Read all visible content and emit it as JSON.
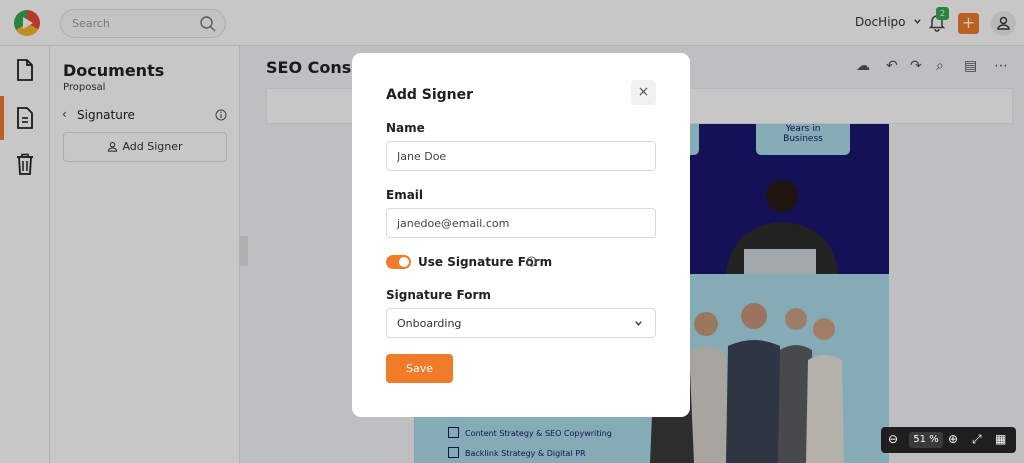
{
  "app": {
    "search": {
      "placeholder": "Search"
    },
    "brand_selector": "DocHipo",
    "notification_count": "2",
    "plus_label": "+"
  },
  "panel": {
    "title": "Documents",
    "subtitle": "Proposal",
    "section": "Signature",
    "add_signer_label": "Add Signer"
  },
  "document": {
    "title": "SEO Consu",
    "card_text": "Years in\nBusiness",
    "checklist": [
      "Content Strategy & SEO Copywriting",
      "Backlink Strategy & Digital PR"
    ]
  },
  "zoom": {
    "value": "51",
    "unit": "%"
  },
  "modal": {
    "title": "Add Signer",
    "close_label": "×",
    "name_label": "Name",
    "name_value": "Jane Doe",
    "email_label": "Email",
    "email_value": "janedoe@email.com",
    "toggle_label": "Use Signature Form",
    "toggle_on": true,
    "signature_form_label": "Signature Form",
    "signature_form_value": "Onboarding",
    "save_label": "Save"
  },
  "colors": {
    "accent": "#f07c2a",
    "doc_navy": "#1c1670",
    "doc_light_blue": "#a9dcea"
  },
  "icons": [
    "search-icon",
    "chevron-down-icon",
    "bell-icon",
    "plus-icon",
    "user-icon",
    "document-icon",
    "form-icon",
    "trash-icon",
    "info-icon",
    "cloud-icon",
    "undo-icon",
    "redo-icon",
    "comment-icon",
    "more-icon",
    "zoom-out-icon",
    "zoom-in-icon",
    "fit-icon",
    "grid-icon",
    "close-icon"
  ]
}
